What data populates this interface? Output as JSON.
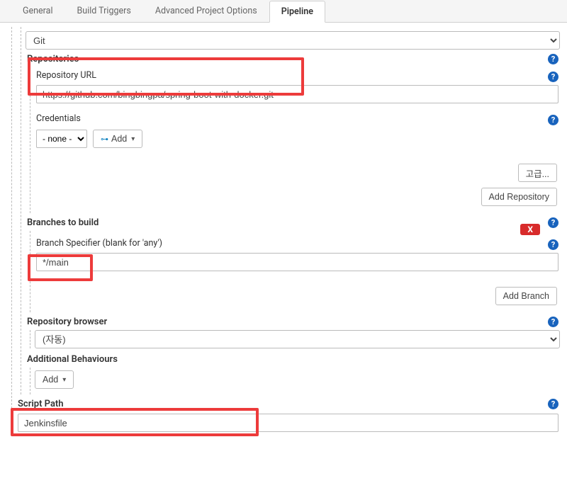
{
  "tabs": {
    "general": "General",
    "build_triggers": "Build Triggers",
    "advanced": "Advanced Project Options",
    "pipeline": "Pipeline"
  },
  "scm_select": "Git",
  "repositories": {
    "title": "Repositories",
    "url_label": "Repository URL",
    "url_value": "https://github.com/bingbingpa/spring-boot-with-docker.git",
    "credentials_label": "Credentials",
    "credentials_value": "- none -",
    "add_button": "Add",
    "advanced_button": "고급...",
    "add_repo_button": "Add Repository"
  },
  "branches": {
    "title": "Branches to build",
    "specifier_label": "Branch Specifier (blank for 'any')",
    "specifier_value": "*/main",
    "add_branch_button": "Add Branch",
    "delete_label": "X"
  },
  "repo_browser": {
    "title": "Repository browser",
    "value": "(자동)"
  },
  "additional": {
    "title": "Additional Behaviours",
    "add_button": "Add"
  },
  "script_path": {
    "title": "Script Path",
    "value": "Jenkinsfile"
  }
}
